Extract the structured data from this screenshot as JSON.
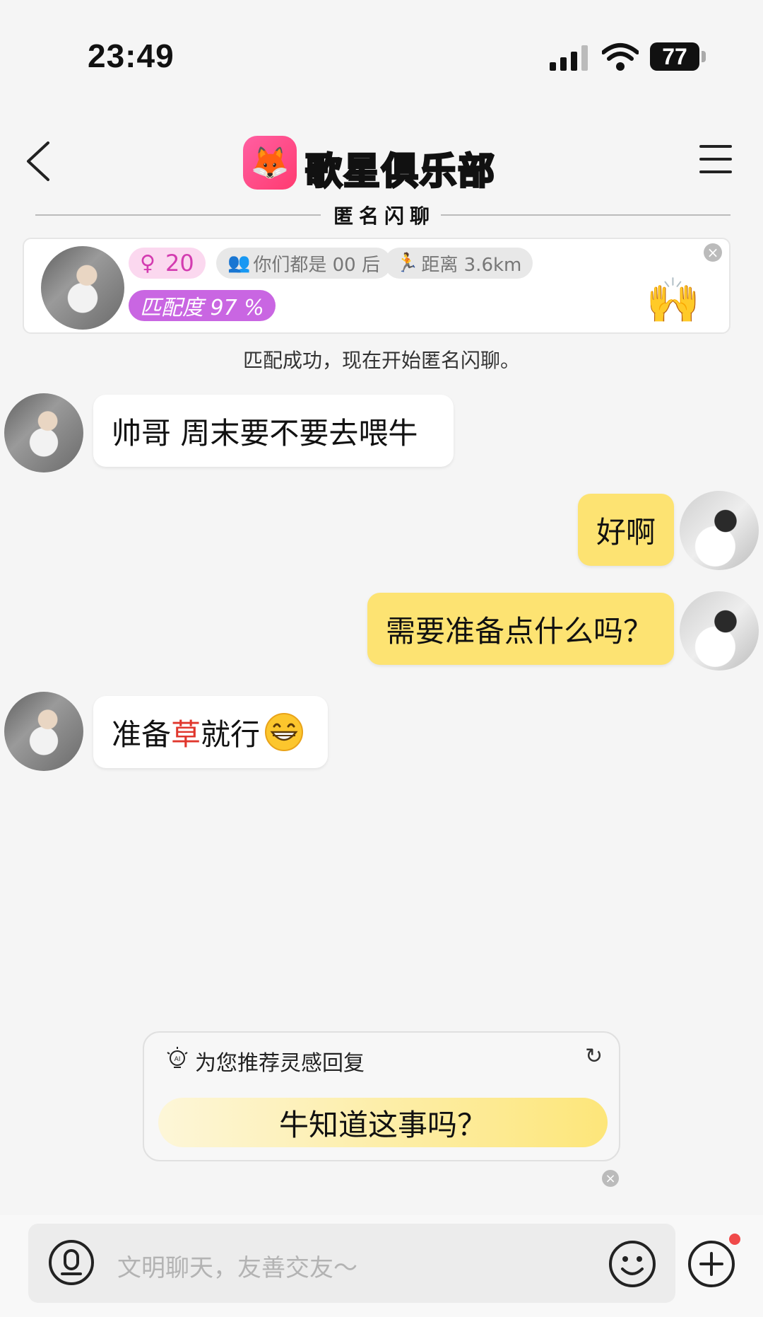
{
  "status_bar": {
    "time": "23:49",
    "battery": "77"
  },
  "header": {
    "app_name": "歌星俱乐部",
    "subtitle": "匿名闪聊",
    "logo_icon": "fox-icon"
  },
  "match_card": {
    "age": "20",
    "generation_tag": "你们都是 00 后",
    "distance_tag": "距离 3.6km",
    "match_score": "匹配度 97 %",
    "close": "×"
  },
  "system_message": "匹配成功，现在开始匿名闪聊。",
  "messages": [
    {
      "side": "in",
      "text": "帅哥 周末要不要去喂牛"
    },
    {
      "side": "out",
      "text": "好啊"
    },
    {
      "side": "out",
      "text": "需要准备点什么吗？"
    },
    {
      "side": "in",
      "text_before": "准备",
      "text_highlight": "草",
      "text_after": "就行",
      "emoji": "grinning-face"
    }
  ],
  "suggestion": {
    "title": "为您推荐灵感回复",
    "reply": "牛知道这事吗？",
    "close": "×"
  },
  "input": {
    "placeholder": "文明聊天，友善交友～"
  },
  "colors": {
    "accent_yellow": "#fde372",
    "title_green": "#3fd12a",
    "match_purple": "#c966e2",
    "highlight_red": "#e0362c"
  }
}
